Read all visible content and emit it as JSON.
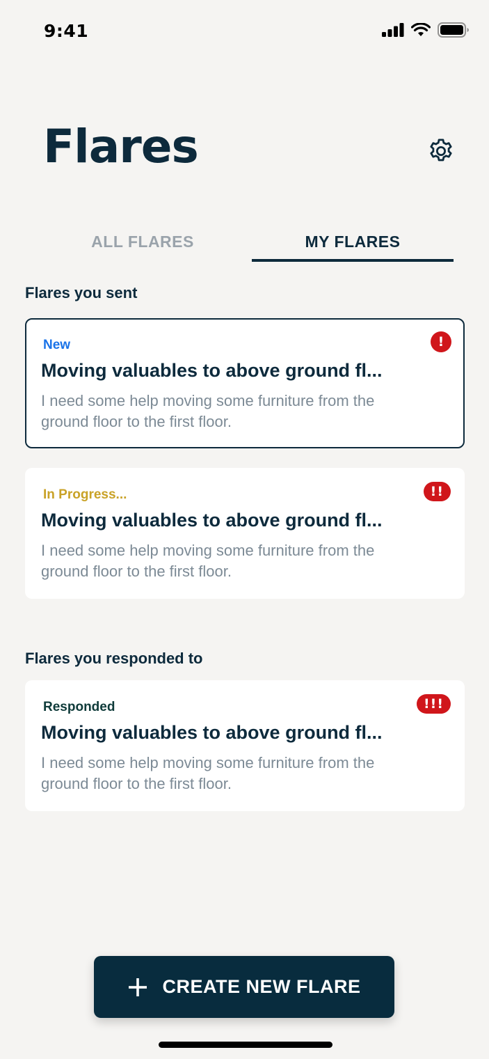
{
  "status_bar": {
    "time": "9:41"
  },
  "header": {
    "title": "Flares"
  },
  "tabs": [
    {
      "label": "ALL FLARES",
      "selected": false
    },
    {
      "label": "MY FLARES",
      "selected": true
    }
  ],
  "sections": [
    {
      "heading": "Flares you sent",
      "cards": [
        {
          "status": "New",
          "status_color": "#1a73e8",
          "urgency": "!",
          "title": "Moving valuables to above ground fl...",
          "description": "I need some help moving some furniture from the ground floor to the first floor.",
          "selected": true
        },
        {
          "status": "In Progress...",
          "status_color": "#c9a227",
          "urgency": "!!",
          "title": "Moving valuables to above ground fl...",
          "description": "I need some help moving some furniture from the ground floor to the first floor.",
          "selected": false
        }
      ]
    },
    {
      "heading": "Flares you responded to",
      "cards": [
        {
          "status": "Responded",
          "status_color": "#0f3b3a",
          "urgency": "!!!",
          "title": "Moving valuables to above ground fl...",
          "description": "I need some help moving some furniture from the ground floor to the first floor.",
          "selected": false
        }
      ]
    }
  ],
  "create_button": {
    "label": "CREATE NEW FLARE",
    "icon": "plus-icon"
  },
  "colors": {
    "primary": "#0d2a3c",
    "urgent_red": "#d0161b",
    "background": "#f5f4f2"
  }
}
